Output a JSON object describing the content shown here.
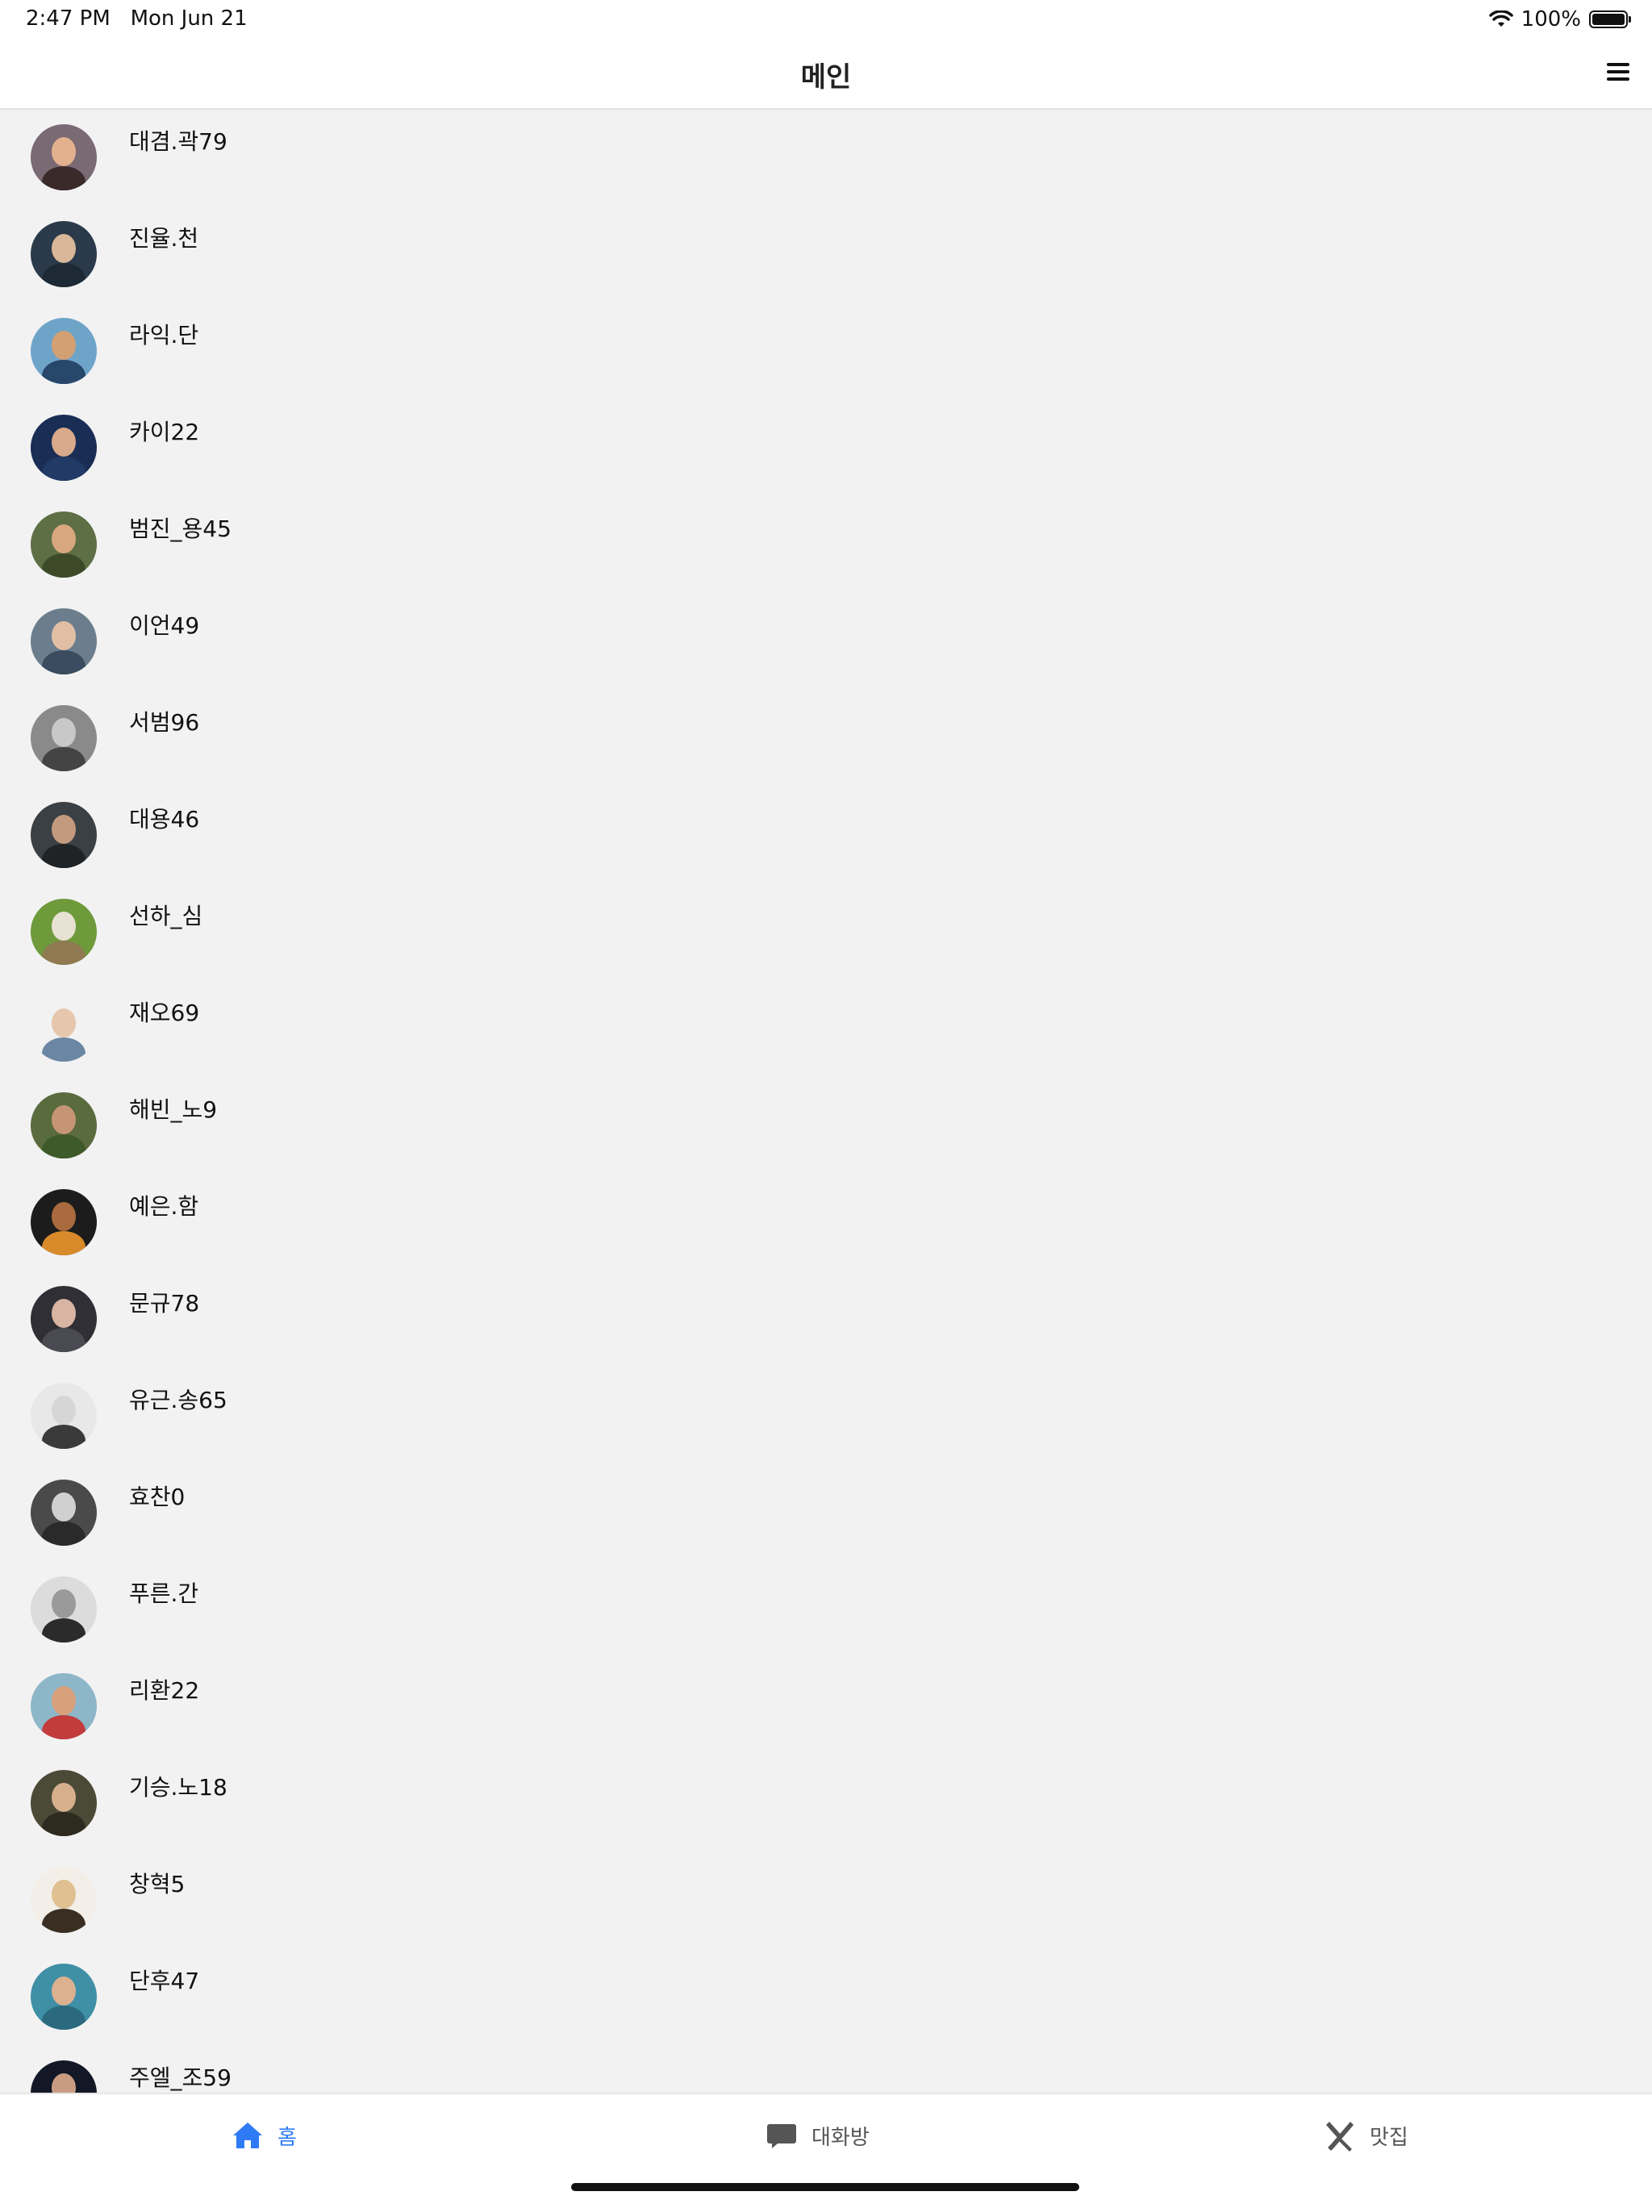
{
  "status_bar": {
    "time": "2:47 PM",
    "date": "Mon Jun 21",
    "battery": "100%"
  },
  "header": {
    "title": "메인"
  },
  "users": [
    {
      "name": "대겸.곽79",
      "avatar_colors": [
        "#7a6a74",
        "#e3b18e",
        "#3a2a2a"
      ]
    },
    {
      "name": "진율.천",
      "avatar_colors": [
        "#2b3a4a",
        "#d9b89a",
        "#1d2a36"
      ]
    },
    {
      "name": "라익.단",
      "avatar_colors": [
        "#6fa4c9",
        "#d2a073",
        "#27476b"
      ]
    },
    {
      "name": "카이22",
      "avatar_colors": [
        "#1a2d55",
        "#d8a98a",
        "#223a66"
      ]
    },
    {
      "name": "범진_용45",
      "avatar_colors": [
        "#5e6e45",
        "#d7a77f",
        "#3d4a2a"
      ]
    },
    {
      "name": "이언49",
      "avatar_colors": [
        "#6c7e8e",
        "#e1bfa5",
        "#3b4c60"
      ]
    },
    {
      "name": "서범96",
      "avatar_colors": [
        "#8a8a8a",
        "#c8c8c8",
        "#444444"
      ]
    },
    {
      "name": "대용46",
      "avatar_colors": [
        "#3a4044",
        "#c49a7e",
        "#1f2326"
      ]
    },
    {
      "name": "선하_심",
      "avatar_colors": [
        "#6e9a3c",
        "#e8e2d4",
        "#8f7a52"
      ]
    },
    {
      "name": "재오69",
      "avatar_colors": [
        "#f2f2f2",
        "#e6c6ac",
        "#6b87a3"
      ]
    },
    {
      "name": "해빈_노9",
      "avatar_colors": [
        "#5a6b3e",
        "#c69674",
        "#3f5a2a"
      ]
    },
    {
      "name": "예은.함",
      "avatar_colors": [
        "#1c1c1c",
        "#a96b3e",
        "#d98a2a"
      ]
    },
    {
      "name": "문규78",
      "avatar_colors": [
        "#2f2f35",
        "#d8b4a2",
        "#4a4a52"
      ]
    },
    {
      "name": "유근.송65",
      "avatar_colors": [
        "#e8e8e8",
        "#d6d6d6",
        "#3a3a3a"
      ]
    },
    {
      "name": "효찬0",
      "avatar_colors": [
        "#4a4a4a",
        "#d0d0d0",
        "#2a2a2a"
      ]
    },
    {
      "name": "푸른.간",
      "avatar_colors": [
        "#dcdcdc",
        "#9a9a9a",
        "#2b2b2b"
      ]
    },
    {
      "name": "리환22",
      "avatar_colors": [
        "#8db7c9",
        "#d9a07c",
        "#c23c3c"
      ]
    },
    {
      "name": "기승.노18",
      "avatar_colors": [
        "#4b4a36",
        "#d6b08d",
        "#2d2a20"
      ]
    },
    {
      "name": "창혁5",
      "avatar_colors": [
        "#f3efe8",
        "#e0c090",
        "#3a2e22"
      ]
    },
    {
      "name": "단후47",
      "avatar_colors": [
        "#3f8fa6",
        "#dcb190",
        "#2b6a7e"
      ]
    },
    {
      "name": "주엘_조59",
      "avatar_colors": [
        "#121826",
        "#c99c82",
        "#0b0f18"
      ]
    }
  ],
  "tabs": [
    {
      "label": "홈",
      "icon": "home-icon",
      "active": true
    },
    {
      "label": "대화방",
      "icon": "chat-bubble-icon",
      "active": false
    },
    {
      "label": "맛집",
      "icon": "utensils-icon",
      "active": false
    }
  ],
  "colors": {
    "accent": "#2f7bf5",
    "inactive_icon": "#555555",
    "list_background": "#f2f2f2"
  }
}
